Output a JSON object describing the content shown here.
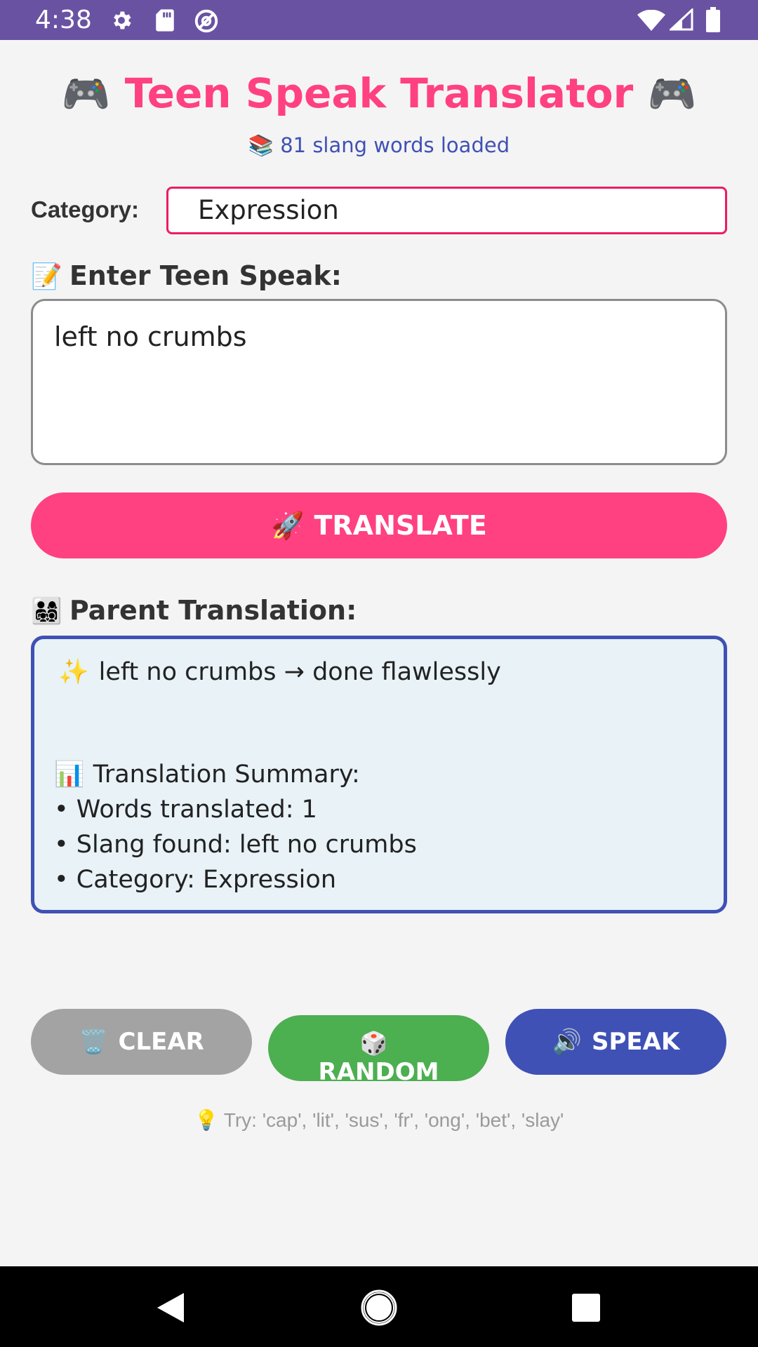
{
  "status_bar": {
    "time": "4:38",
    "left_icons": [
      "gear-icon",
      "sd-card-icon",
      "no-sync-icon"
    ],
    "right_icons": [
      "wifi-icon",
      "signal-icon",
      "battery-icon"
    ],
    "background": "#6a52a3"
  },
  "header": {
    "title": "Teen Speak Translator",
    "title_emoji_left": "🎮",
    "title_emoji_right": "🎮",
    "title_color": "#ff4081",
    "subtitle_emoji": "📚",
    "subtitle": "81 slang words loaded"
  },
  "category": {
    "label": "Category:",
    "selected": "Expression"
  },
  "input_section": {
    "emoji": "📝",
    "label": "Enter Teen Speak:",
    "value": "left no crumbs"
  },
  "translate_button": {
    "emoji": "🚀",
    "label": "TRANSLATE",
    "color": "#ff4081"
  },
  "output_section": {
    "emoji": "👨‍👩‍👧‍👦",
    "label": "Parent Translation:",
    "main_emoji": "✨",
    "main_line": "left no crumbs → done flawlessly",
    "summary_emoji": "📊",
    "summary_title": "Translation Summary:",
    "summary_items": [
      "• Words translated: 1",
      "• Slang found: left no crumbs",
      "• Category: Expression"
    ]
  },
  "actions": {
    "clear": {
      "emoji": "🗑️",
      "label": "CLEAR",
      "color": "#a3a3a3"
    },
    "random": {
      "emoji": "🎲",
      "label": "RANDOM",
      "color": "#4caf50"
    },
    "speak": {
      "emoji": "🔊",
      "label": "SPEAK",
      "color": "#3f51b5"
    }
  },
  "tip": {
    "emoji": "💡",
    "text": "Try: 'cap', 'lit', 'sus', 'fr', 'ong', 'bet', 'slay'"
  },
  "nav_bar": {
    "icons": [
      "back-icon",
      "home-icon",
      "recents-icon"
    ]
  }
}
